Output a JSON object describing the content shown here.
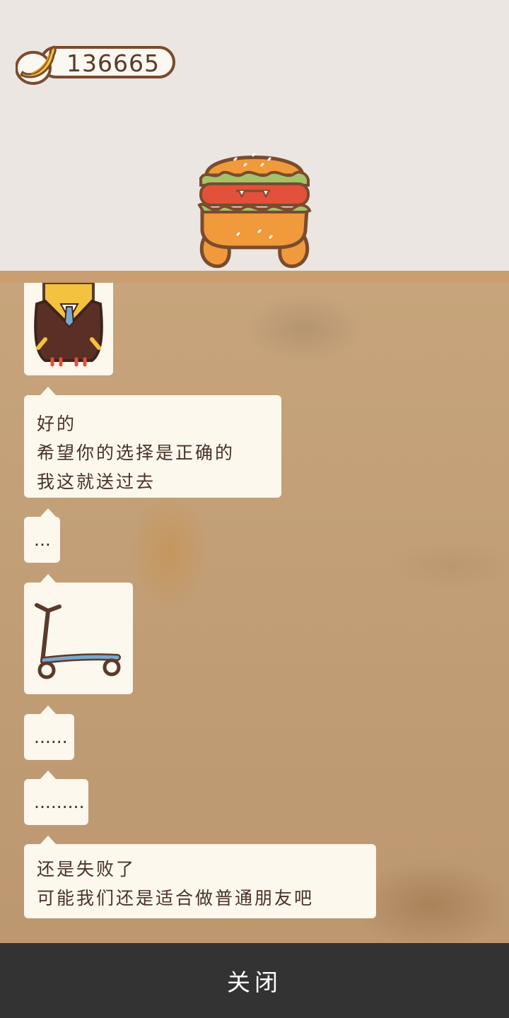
{
  "currency": {
    "icon": "banana-icon",
    "value": "136665"
  },
  "character": {
    "icon": "burger-character"
  },
  "messages": [
    {
      "type": "image",
      "icon": "suited-character-image"
    },
    {
      "type": "text",
      "lines": [
        "好的",
        "希望你的选择是正确的",
        "我这就送过去"
      ]
    },
    {
      "type": "text",
      "lines": [
        "..."
      ]
    },
    {
      "type": "image",
      "icon": "scooter-image"
    },
    {
      "type": "text",
      "lines": [
        "......"
      ]
    },
    {
      "type": "text",
      "lines": [
        "........."
      ]
    },
    {
      "type": "text",
      "lines": [
        "还是失败了",
        "可能我们还是适合做普通朋友吧"
      ]
    }
  ],
  "close_button": {
    "label": "关闭"
  },
  "colors": {
    "bubble": "#fcf8ee",
    "text": "#4a3226",
    "shelf": "#c99e70",
    "bottom_bar": "#333333"
  }
}
